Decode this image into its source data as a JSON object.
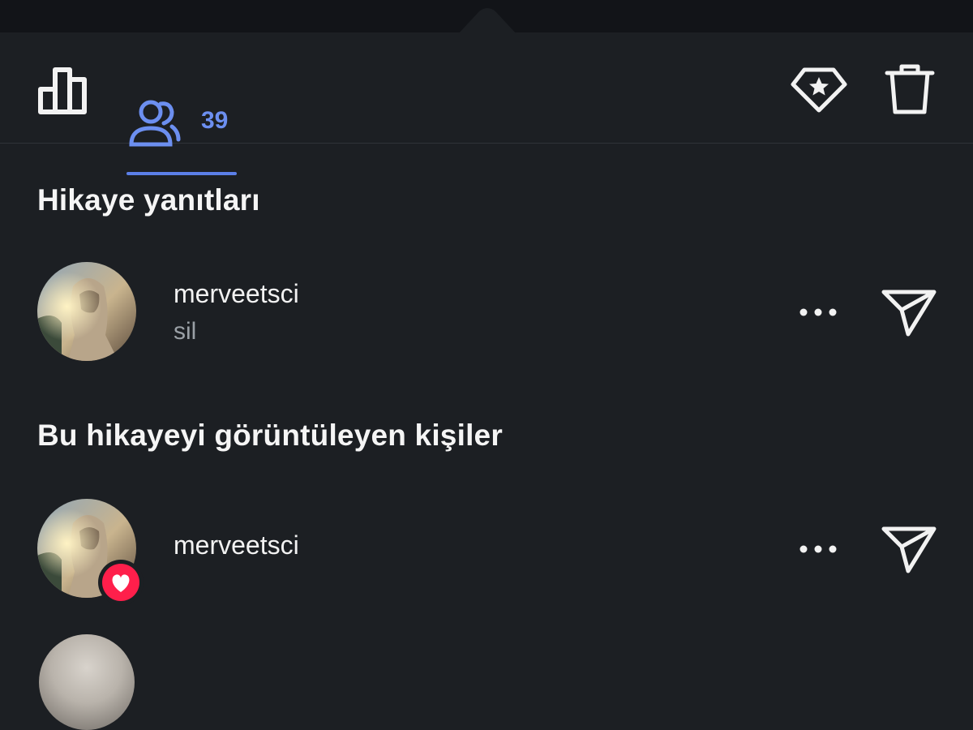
{
  "tabs": {
    "viewers_count": "39"
  },
  "sections": {
    "replies_title": "Hikaye yanıtları",
    "viewers_title": "Bu hikayeyi görüntüleyen kişiler"
  },
  "replies": [
    {
      "username": "merveetsci",
      "message": "sil"
    }
  ],
  "viewers": [
    {
      "username": "merveetsci",
      "liked": true
    }
  ],
  "colors": {
    "background": "#1c1f23",
    "accent": "#5b7fe8",
    "like": "#ff1f4b",
    "secondary_text": "#9aa0a6"
  },
  "icons": {
    "stats": "bar-chart-icon",
    "viewers": "people-icon",
    "highlight": "diamond-star-icon",
    "delete": "trash-icon",
    "more": "more-dots-icon",
    "send": "paper-plane-icon",
    "like": "heart-icon"
  }
}
